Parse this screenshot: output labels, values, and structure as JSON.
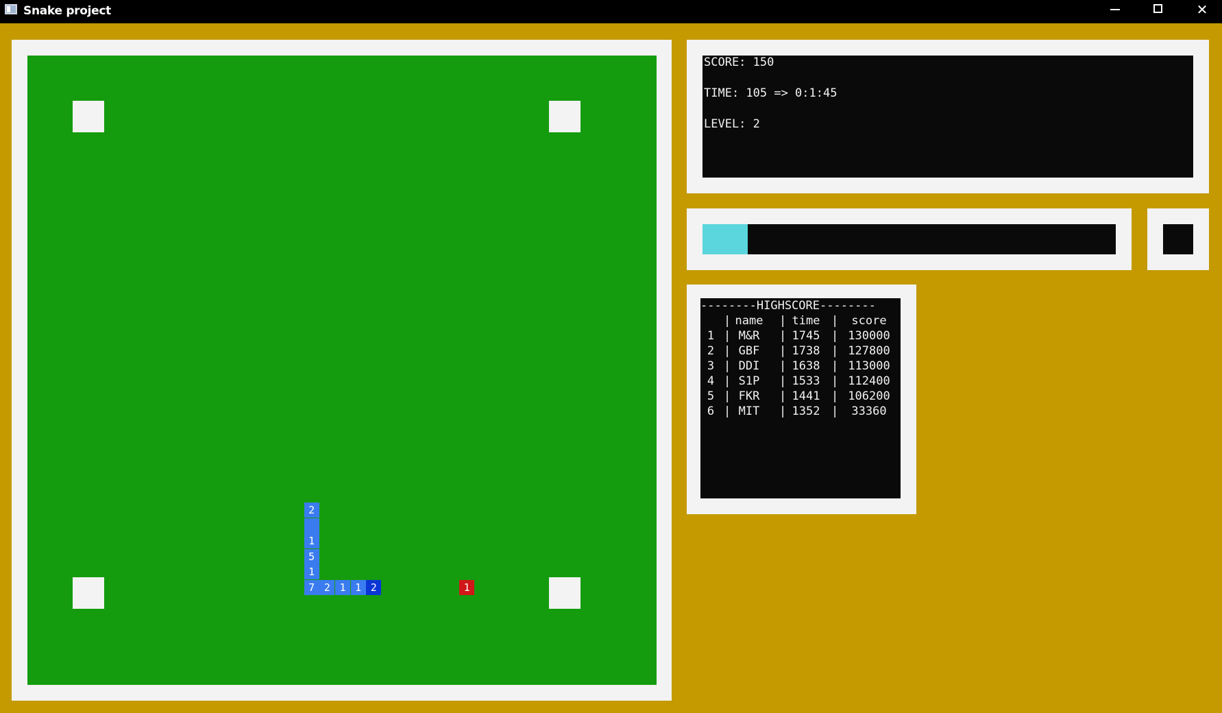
{
  "window": {
    "title": "Snake project"
  },
  "info": {
    "score": "SCORE: 150",
    "time": "TIME: 105 => 0:1:45",
    "level": "LEVEL: 2"
  },
  "progress": {
    "fraction": 0.11,
    "fill_color": "#5ad6dc"
  },
  "highscore": {
    "title": "--------HIGHSCORE--------",
    "headers": [
      "",
      "name",
      "time",
      "score"
    ],
    "rows": [
      [
        "1",
        "M&R",
        "1745",
        "130000"
      ],
      [
        "2",
        "GBF",
        "1738",
        "127800"
      ],
      [
        "3",
        "DDI",
        "1638",
        "113000"
      ],
      [
        "4",
        "S1P",
        "1533",
        "112400"
      ],
      [
        "5",
        "FKR",
        "1441",
        "106200"
      ],
      [
        "6",
        "MIT",
        "1352",
        "33360"
      ]
    ]
  },
  "game": {
    "snake": [
      {
        "label": "2",
        "col": 18,
        "row": 29
      },
      {
        "label": "",
        "col": 18,
        "row": 30
      },
      {
        "label": "1",
        "col": 18,
        "row": 31
      },
      {
        "label": "5",
        "col": 18,
        "row": 32
      },
      {
        "label": "1",
        "col": 18,
        "row": 33
      },
      {
        "label": "7",
        "col": 18,
        "row": 34
      },
      {
        "label": "2",
        "col": 19,
        "row": 34
      },
      {
        "label": "1",
        "col": 20,
        "row": 34
      },
      {
        "label": "1",
        "col": 21,
        "row": 34
      },
      {
        "label": "2",
        "col": 22,
        "row": 34,
        "head": true
      }
    ],
    "food": {
      "label": "1",
      "col": 28,
      "row": 34
    },
    "colors": {
      "board": "#149c0e",
      "snake": "#3a7cf0",
      "head": "#0b36d6",
      "food": "#d01818",
      "background": "#c49a00"
    }
  }
}
